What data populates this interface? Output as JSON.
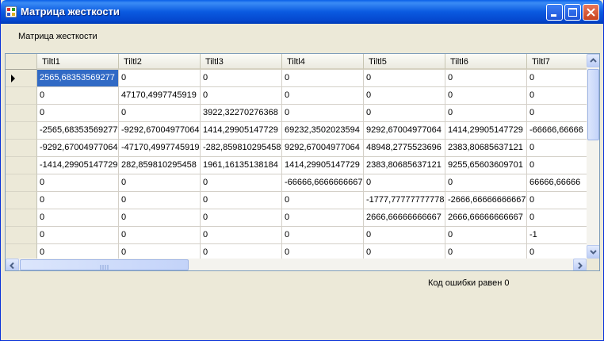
{
  "window": {
    "title": "Матрица жесткости"
  },
  "menu": {
    "label": "Матрица жесткости"
  },
  "grid": {
    "columns": [
      "Tiltl1",
      "Tiltl2",
      "Tiltl3",
      "Tiltl4",
      "Tiltl5",
      "Tiltl6",
      "Tiltl7"
    ],
    "rows": [
      [
        "2565,68353569277",
        "0",
        "0",
        "0",
        "0",
        "0",
        "0"
      ],
      [
        "0",
        "47170,4997745919",
        "0",
        "0",
        "0",
        "0",
        "0"
      ],
      [
        "0",
        "0",
        "3922,32270276368",
        "0",
        "0",
        "0",
        "0"
      ],
      [
        "-2565,68353569277",
        "-9292,67004977064",
        "1414,29905147729",
        "69232,3502023594",
        "9292,67004977064",
        "1414,29905147729",
        "-66666,66666"
      ],
      [
        "-9292,67004977064",
        "-47170,4997745919",
        "-282,859810295458",
        "9292,67004977064",
        "48948,2775523696",
        "2383,80685637121",
        "0"
      ],
      [
        "-1414,29905147729",
        "282,859810295458",
        "1961,16135138184",
        "1414,29905147729",
        "2383,80685637121",
        "9255,65603609701",
        "0"
      ],
      [
        "0",
        "0",
        "0",
        "-66666,6666666667",
        "0",
        "0",
        "66666,66666"
      ],
      [
        "0",
        "0",
        "0",
        "0",
        "-1777,77777777778",
        "-2666,66666666667",
        "0"
      ],
      [
        "0",
        "0",
        "0",
        "0",
        "2666,66666666667",
        "2666,66666666667",
        "0"
      ],
      [
        "0",
        "0",
        "0",
        "0",
        "0",
        "0",
        "-1"
      ],
      [
        "0",
        "0",
        "0",
        "0",
        "0",
        "0",
        "0"
      ]
    ],
    "selected_cell": "2565,68353569277"
  },
  "status": {
    "text": "Код ошибки равен 0"
  }
}
